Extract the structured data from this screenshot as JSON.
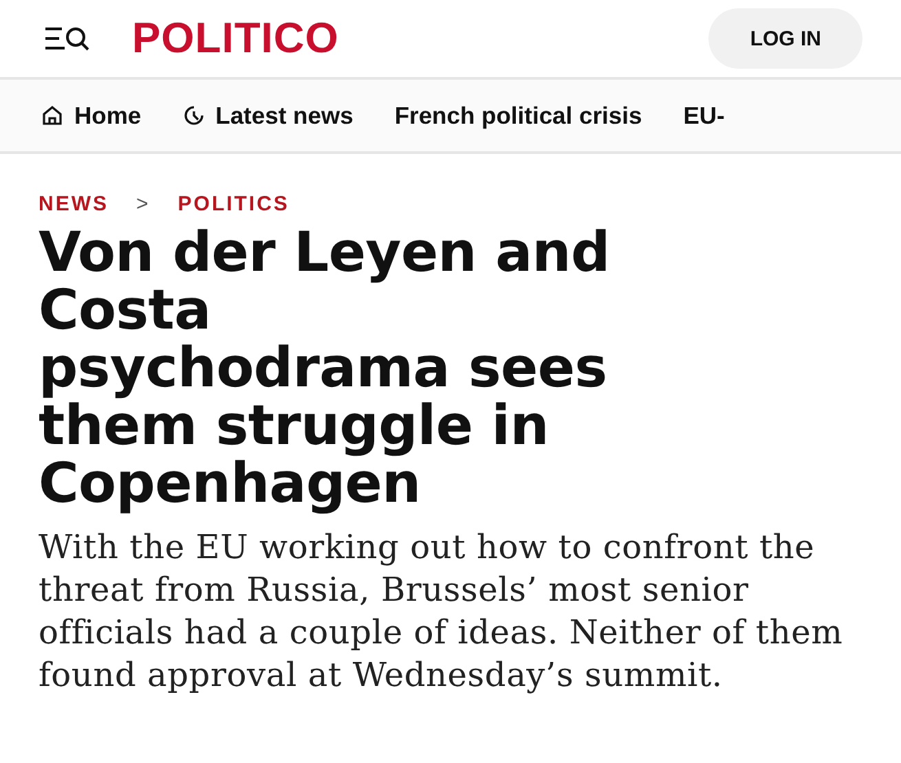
{
  "header": {
    "logo": "POLITICO",
    "login_button": "LOG IN"
  },
  "nav": [
    {
      "label": "Home",
      "kind": "home"
    },
    {
      "label": "Latest news",
      "kind": "latest"
    },
    {
      "label": "French political crisis",
      "kind": "topic"
    },
    {
      "label": "EU-",
      "kind": "topic"
    }
  ],
  "breadcrumb": [
    "NEWS",
    ">",
    "POLITICS"
  ],
  "headline": "Von der Leyen and Costa psychodrama sees them struggle in Copenhagen",
  "standfirst": "With the EU working out how to confront the threat from Russia, Brussels’ most senior officials had a couple of ideas. Neither of them found approval at Wednesday’s summit."
}
